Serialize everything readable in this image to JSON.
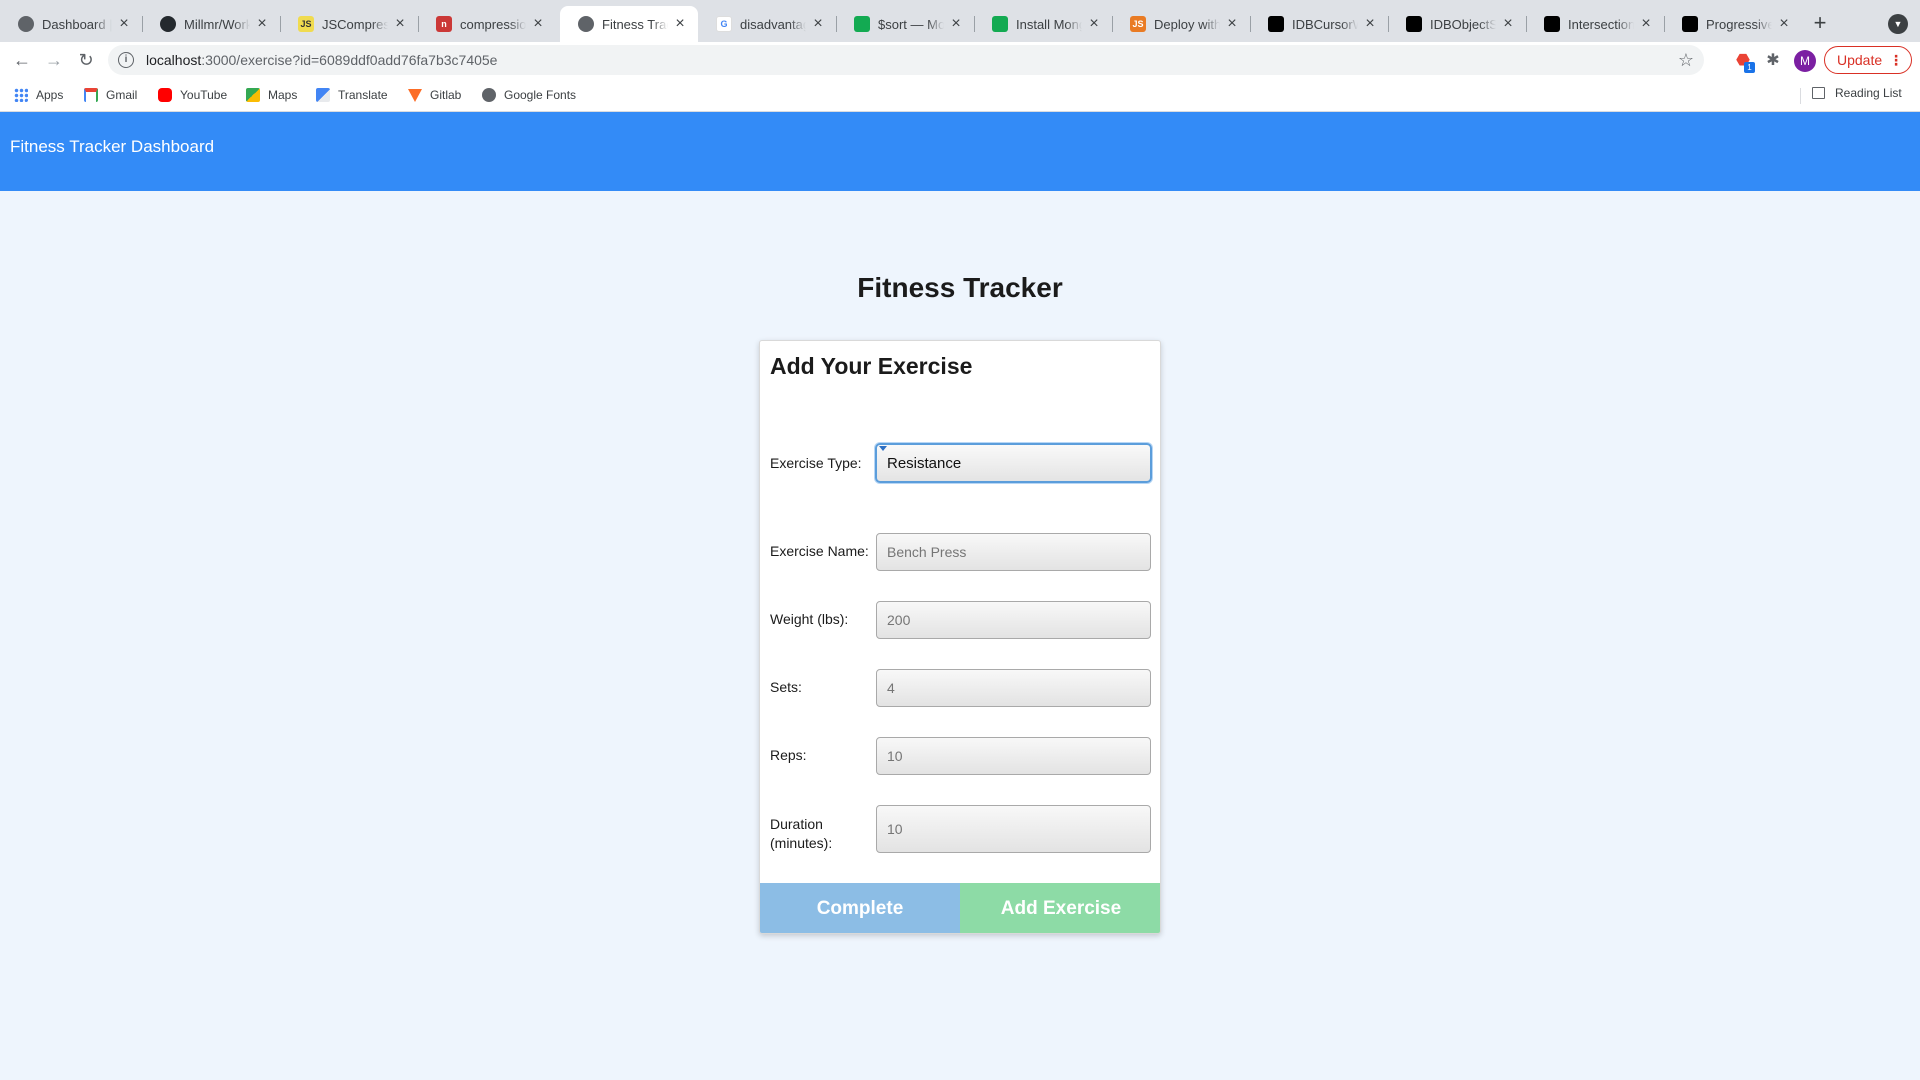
{
  "browser": {
    "tabs": [
      {
        "title": "Dashboard | Heroku",
        "icon": "globe-icon",
        "color": "#5f6368"
      },
      {
        "title": "Millmr/Workout",
        "icon": "github-icon",
        "color": "#24292e"
      },
      {
        "title": "JSCompress",
        "icon": "js-icon",
        "color": "#f0db4f"
      },
      {
        "title": "compression",
        "icon": "npm-icon",
        "color": "#cb3837"
      },
      {
        "title": "Fitness Tracker",
        "icon": "globe-icon",
        "color": "#5f6368",
        "active": true
      },
      {
        "title": "disadvantages",
        "icon": "google-icon",
        "color": "#4285f4"
      },
      {
        "title": "$sort — MongoDB",
        "icon": "mongodb-icon",
        "color": "#13aa52"
      },
      {
        "title": "Install MongoDB",
        "icon": "mongodb-icon",
        "color": "#13aa52"
      },
      {
        "title": "Deploy with Heroku",
        "icon": "js-icon",
        "color": "#e97b24"
      },
      {
        "title": "IDBCursorWithValue",
        "icon": "mdn-icon",
        "color": "#000000"
      },
      {
        "title": "IDBObjectStore",
        "icon": "mdn-icon",
        "color": "#000000"
      },
      {
        "title": "Intersection Observer",
        "icon": "mdn-icon",
        "color": "#000000"
      },
      {
        "title": "Progressive Web Apps",
        "icon": "mdn-icon",
        "color": "#000000"
      }
    ],
    "url_host": "localhost",
    "url_rest": ":3000/exercise?id=6089ddf0add76fa7b3c7405e",
    "update_label": "Update",
    "avatar_letter": "M",
    "extension_badge": "1",
    "bookmarks": [
      {
        "label": "Apps",
        "icon": "apps-grid-icon",
        "color": "#4285f4"
      },
      {
        "label": "Gmail",
        "icon": "gmail-icon",
        "color": "#ea4335"
      },
      {
        "label": "YouTube",
        "icon": "youtube-icon",
        "color": "#ff0000"
      },
      {
        "label": "Maps",
        "icon": "maps-icon",
        "color": "#34a853"
      },
      {
        "label": "Translate",
        "icon": "translate-icon",
        "color": "#4285f4"
      },
      {
        "label": "Gitlab",
        "icon": "gitlab-icon",
        "color": "#fc6d26"
      },
      {
        "label": "Google Fonts",
        "icon": "globe-icon",
        "color": "#5f6368"
      }
    ],
    "reading_list": "Reading List"
  },
  "app": {
    "brand": "Fitness Tracker Dashboard",
    "page_title": "Fitness Tracker",
    "colors": {
      "nav": "#338bf7",
      "background": "#eef5fd",
      "complete": "#8cbde5",
      "add": "#8ddba6"
    }
  },
  "form": {
    "title": "Add Your Exercise",
    "type_label": "Exercise Type:",
    "type_value": "Resistance",
    "name_label": "Exercise Name:",
    "name_placeholder": "Bench Press",
    "weight_label": "Weight (lbs):",
    "weight_placeholder": "200",
    "sets_label": "Sets:",
    "sets_placeholder": "4",
    "reps_label": "Reps:",
    "reps_placeholder": "10",
    "duration_label_1": "Duration",
    "duration_label_2": "(minutes):",
    "duration_placeholder": "10",
    "complete_label": "Complete",
    "add_label": "Add Exercise"
  }
}
